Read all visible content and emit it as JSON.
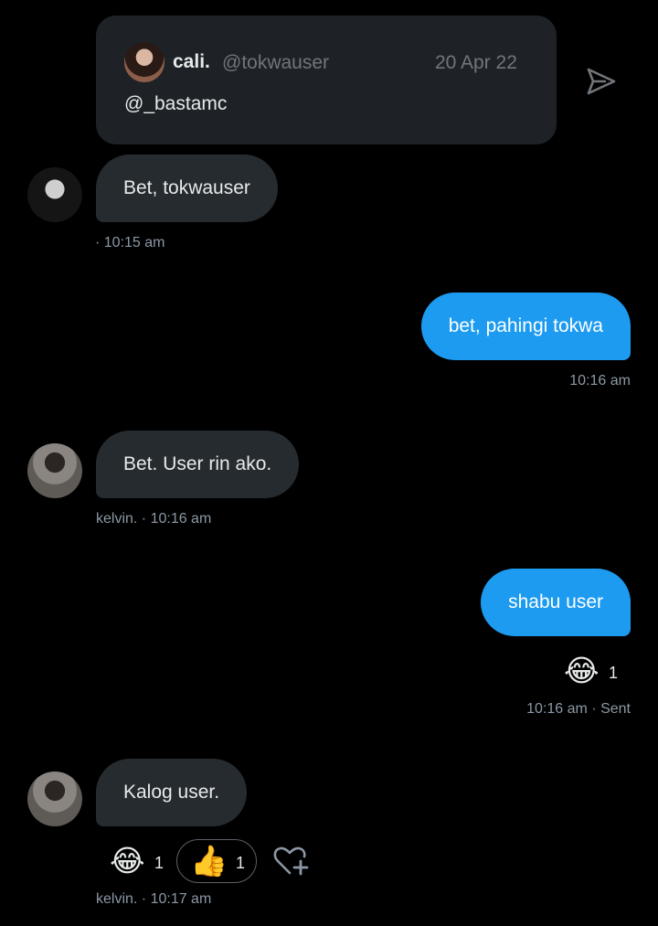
{
  "quote": {
    "name": "cali.",
    "handle": "@tokwauser",
    "date": "20 Apr 22",
    "text": "@_bastamc"
  },
  "messages": [
    {
      "text": "Bet, tokwauser",
      "meta": "· 10:15 am"
    },
    {
      "text": "bet, pahingi tokwa",
      "meta": "10:16 am"
    },
    {
      "text": "Bet. User rin ako.",
      "meta": "kelvin. · 10:16 am"
    },
    {
      "text": "shabu user",
      "meta": "10:16 am · Sent",
      "reaction_emoji": "😂",
      "reaction_count": "1"
    },
    {
      "text": "Kalog user.",
      "meta": "kelvin. · 10:17 am",
      "reactions": [
        {
          "emoji": "😂",
          "count": "1"
        },
        {
          "emoji": "👍",
          "count": "1"
        }
      ]
    }
  ],
  "icons": {
    "send": "send-icon",
    "add_reaction": "heart-plus-icon"
  },
  "colors": {
    "outgoing_bubble": "#1d9bf0",
    "incoming_bubble": "#262b30",
    "background": "#000000",
    "muted_text": "#8b98a5"
  }
}
